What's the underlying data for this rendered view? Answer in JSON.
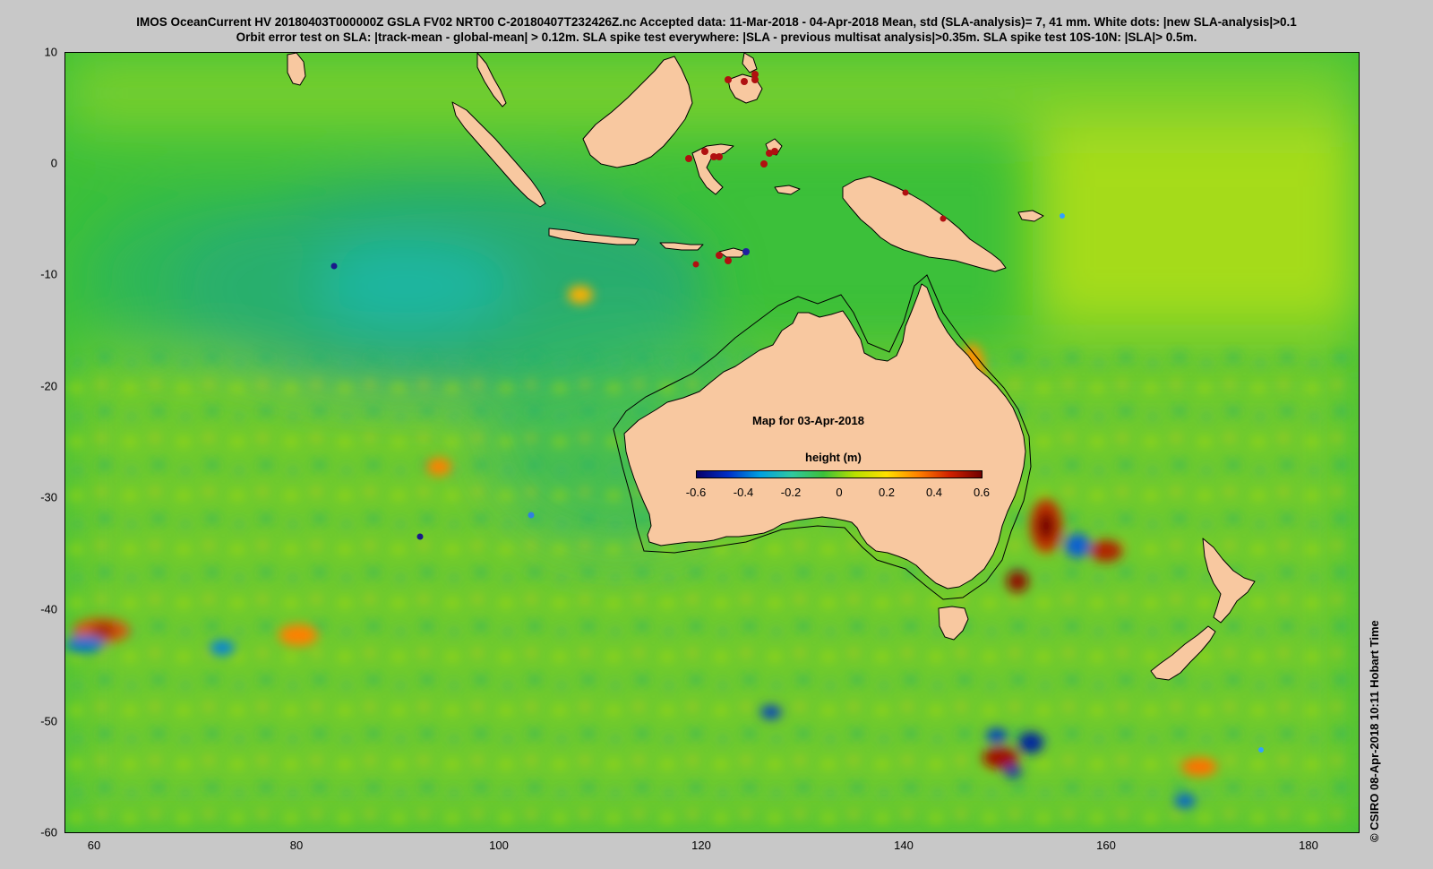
{
  "header": {
    "line1": "IMOS OceanCurrent HV 20180403T000000Z GSLA FV02 NRT00 C-20180407T232426Z.nc  Accepted data: 11-Mar-2018 - 04-Apr-2018 Mean, std (SLA-analysis)= 7, 41 mm. White dots: |new SLA-analysis|>0.1",
    "line2": "Orbit error test on SLA: |track-mean  - global-mean| > 0.12m.  SLA spike test everywhere: |SLA - previous multisat analysis|>0.35m. SLA spike test 10S-10N: |SLA|> 0.5m."
  },
  "map": {
    "date_label": "Map for 03-Apr-2018",
    "lon_range": [
      57,
      185
    ],
    "lat_range": [
      -60,
      10
    ],
    "lon_ticks": [
      "60",
      "80",
      "100",
      "120",
      "140",
      "160",
      "180"
    ],
    "lat_ticks": [
      "10",
      "0",
      "-10",
      "-20",
      "-30",
      "-40",
      "-50",
      "-60"
    ],
    "ocean_color": "#3cc03a",
    "land_color": "#f8c8a0"
  },
  "colorbar": {
    "title": "height (m)",
    "range": [
      -0.6,
      0.6
    ],
    "ticks": [
      "-0.6",
      "-0.4",
      "-0.2",
      "0",
      "0.2",
      "0.4",
      "0.6"
    ],
    "colors": [
      "#08006a",
      "#0030c8",
      "#00a0e0",
      "#30c8a0",
      "#3cc03a",
      "#b8e000",
      "#ffe000",
      "#ff8000",
      "#d02000",
      "#700000"
    ]
  },
  "side_note": "© CSIRO 08-Apr-2018 10:11 Hobart Time"
}
